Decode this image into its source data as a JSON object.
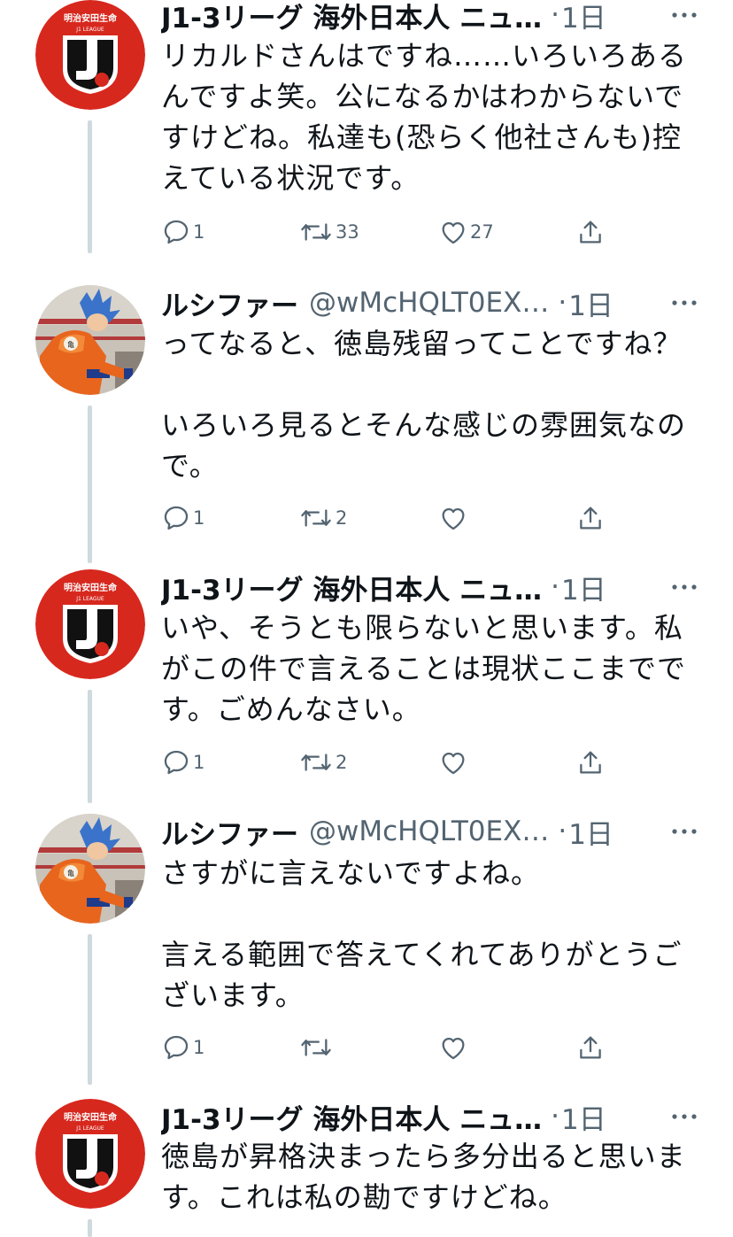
{
  "colors": {
    "text": "#0f1419",
    "secondary": "#536471",
    "thread_line": "#cfd9de",
    "jleague_red": "#d7281e"
  },
  "logo": {
    "top_text": "明治安田生命",
    "bottom_text": "J1 LEAGUE"
  },
  "tweets": [
    {
      "name": "J1-3リーグ 海外日本人 ニュ…",
      "handle": "",
      "dot": "·",
      "time": "1日",
      "avatar": "jleague-logo",
      "text": "リカルドさんはですね……いろいろあるんですよ笑。公になるかはわからないですけどね。私達も(恐らく他社さんも)控えている状況です。",
      "reply_count": "1",
      "retweet_count": "33",
      "like_count": "27"
    },
    {
      "name": "ルシファー",
      "handle": "@wMcHQLT0EX…",
      "dot": "·",
      "time": "1日",
      "avatar": "goku-figure-photo",
      "text": "ってなると、徳島残留ってことですね？\n\nいろいろ見るとそんな感じの雰囲気なので。",
      "reply_count": "1",
      "retweet_count": "2",
      "like_count": ""
    },
    {
      "name": "J1-3リーグ 海外日本人 ニュ…",
      "handle": "",
      "dot": "·",
      "time": "1日",
      "avatar": "jleague-logo",
      "text": "いや、そうとも限らないと思います。私がこの件で言えることは現状ここまでです。ごめんなさい。",
      "reply_count": "1",
      "retweet_count": "2",
      "like_count": ""
    },
    {
      "name": "ルシファー",
      "handle": "@wMcHQLT0EX…",
      "dot": "·",
      "time": "1日",
      "avatar": "goku-figure-photo",
      "text": "さすがに言えないですよね。\n\n言える範囲で答えてくれてありがとうございます。",
      "reply_count": "1",
      "retweet_count": "",
      "like_count": ""
    },
    {
      "name": "J1-3リーグ 海外日本人 ニュ…",
      "handle": "",
      "dot": "·",
      "time": "1日",
      "avatar": "jleague-logo",
      "text": "徳島が昇格決まったら多分出ると思います。これは私の勘ですけどね。"
    }
  ]
}
